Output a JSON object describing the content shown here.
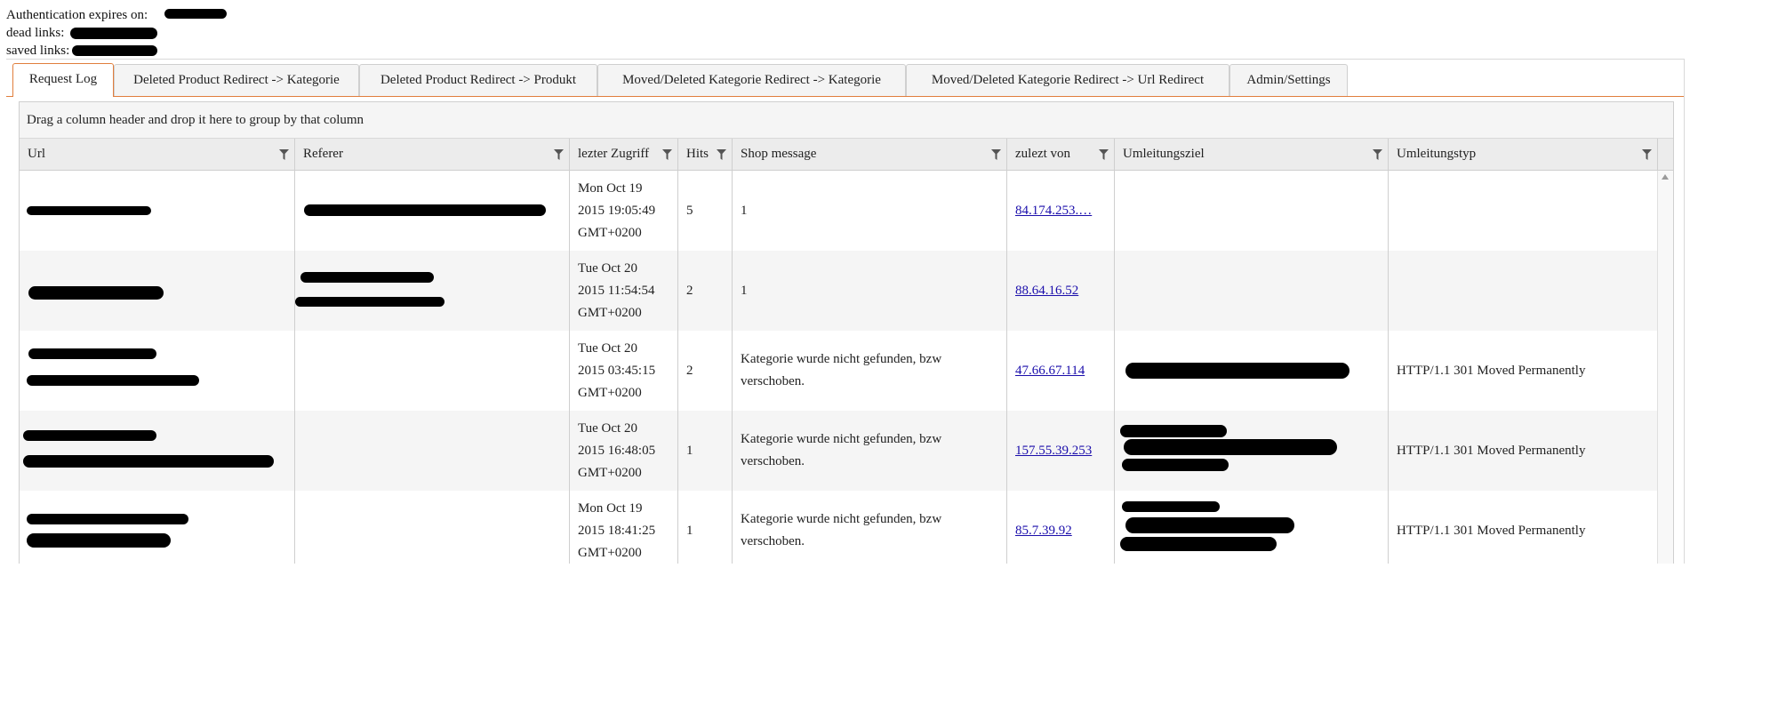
{
  "info": {
    "auth_label": "Authentication expires on:",
    "dead_label": "dead links:",
    "saved_label": "saved links:"
  },
  "tabs": [
    {
      "label": "Request Log",
      "active": true
    },
    {
      "label": "Deleted Product Redirect -> Kategorie",
      "active": false
    },
    {
      "label": "Deleted Product Redirect -> Produkt",
      "active": false
    },
    {
      "label": "Moved/Deleted Kategorie Redirect -> Kategorie",
      "active": false
    },
    {
      "label": "Moved/Deleted Kategorie Redirect -> Url Redirect",
      "active": false
    },
    {
      "label": "Admin/Settings",
      "active": false
    }
  ],
  "grid": {
    "group_hint": "Drag a column header and drop it here to group by that column",
    "columns": [
      "Url",
      "Referer",
      "lezter Zugriff",
      "Hits",
      "Shop message",
      "zulezt von",
      "Umleitungsziel",
      "Umleitungstyp"
    ],
    "rows": [
      {
        "date1": "Mon Oct 19",
        "date2": "2015 19:05:49",
        "date3": "GMT+0200",
        "hits": "5",
        "message": "1",
        "ip": "84.174.253.…",
        "type": ""
      },
      {
        "date1": "Tue Oct 20",
        "date2": "2015 11:54:54",
        "date3": "GMT+0200",
        "hits": "2",
        "message": "1",
        "ip": "88.64.16.52",
        "type": ""
      },
      {
        "date1": "Tue Oct 20",
        "date2": "2015 03:45:15",
        "date3": "GMT+0200",
        "hits": "2",
        "message": "Kategorie wurde nicht gefunden, bzw verschoben.",
        "ip": "47.66.67.114",
        "type": "HTTP/1.1 301 Moved Permanently"
      },
      {
        "date1": "Tue Oct 20",
        "date2": "2015 16:48:05",
        "date3": "GMT+0200",
        "hits": "1",
        "message": "Kategorie wurde nicht gefunden, bzw verschoben.",
        "ip": "157.55.39.253",
        "type": "HTTP/1.1 301 Moved Permanently"
      },
      {
        "date1": "Mon Oct 19",
        "date2": "2015 18:41:25",
        "date3": "GMT+0200",
        "hits": "1",
        "message": "Kategorie wurde nicht gefunden, bzw verschoben.",
        "ip": "85.7.39.92",
        "type": "HTTP/1.1 301 Moved Permanently"
      }
    ]
  },
  "colors": {
    "accent": "#e17e3d",
    "link": "#1a0dab"
  }
}
